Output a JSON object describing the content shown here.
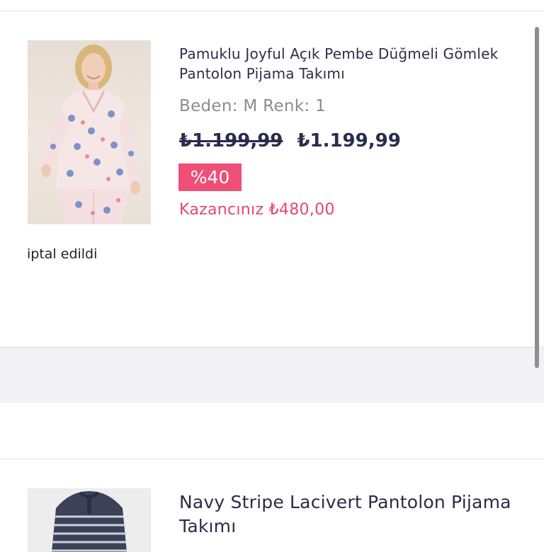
{
  "orders": [
    {
      "title": "Pamuklu Joyful Açık Pembe Düğmeli Gömlek Pantolon Pijama Takımı",
      "variant": "Beden: M Renk: 1",
      "old_price": "₺1.199,99",
      "price": "₺1.199,99",
      "discount": "%40",
      "savings": "Kazancınız ₺480,00",
      "status": "iptal edildi",
      "image": "pink-floral-pajama-photo"
    },
    {
      "title": "Navy Stripe Lacivert Pantolon Pijama Takımı",
      "image": "navy-striped-pajama-photo"
    }
  ],
  "colors": {
    "title": "#2d2e4a",
    "muted": "#8a8b93",
    "price": "#2a2c4d",
    "accent": "#ef4f77",
    "band": "#f2f2f4"
  }
}
